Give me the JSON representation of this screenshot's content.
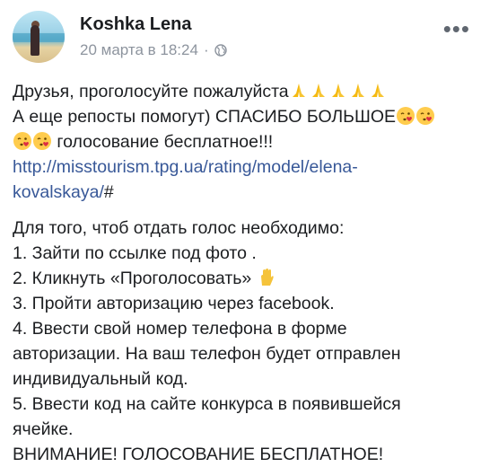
{
  "author": {
    "name": "Koshka Lena"
  },
  "timestamp": "20 марта в 18:24",
  "separator": "·",
  "more_label": "•••",
  "post": {
    "line1": "Друзья, проголосуйте пожалуйста",
    "line2": "А еще репосты помогут) СПАСИБО БОЛЬШОЕ",
    "line3": " голосование бесплатное!!!",
    "link_part1": "http://misstourism.tpg.ua/rating/model/elena-",
    "link_part2": "kovalskaya/",
    "link_hash": "#",
    "instructions": [
      "Для того, чтоб отдать голос необходимо:",
      "1. Зайти по ссылке под фото .",
      "2. Кликнуть «Проголосовать» ",
      "3. Пройти авторизацию через facebook.",
      "4. Ввести свой номер телефона в форме",
      "авторизации. На ваш телефон будет отправлен",
      "индивидуальный код.",
      "5. Ввести код на сайте конкурса в появившейся",
      "ячейке.",
      "ВНИМАНИЕ! ГОЛОСОВАНИЕ БЕСПЛАТНОЕ!"
    ]
  },
  "icons": {
    "praying": "pray-emoji",
    "kiss": "kissing-heart-emoji",
    "hand": "raised-hand-emoji",
    "privacy": "globe-icon"
  },
  "colors": {
    "link": "#385898",
    "meta": "#8d949e",
    "text": "#1c1e21"
  }
}
